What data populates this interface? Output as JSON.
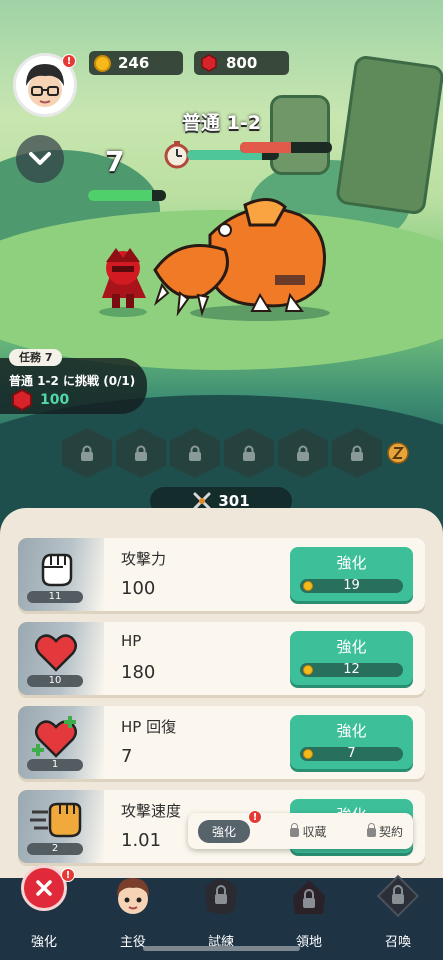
{
  "header": {
    "gold": "246",
    "gems": "800",
    "stage_title": "普通 1-2",
    "wave_number": "7"
  },
  "quest": {
    "tag": "任務 7",
    "description": "普通 1-2 に挑戦 (0/1)",
    "reward": "100"
  },
  "combat_power": "301",
  "upgrades": [
    {
      "name": "攻撃力",
      "value": "100",
      "level": "11",
      "button_label": "強化",
      "cost": "19",
      "icon": "fist-icon"
    },
    {
      "name": "HP",
      "value": "180",
      "level": "10",
      "button_label": "強化",
      "cost": "12",
      "icon": "heart-icon"
    },
    {
      "name": "HP 回復",
      "value": "7",
      "level": "1",
      "button_label": "強化",
      "cost": "7",
      "icon": "heart-regen-icon"
    },
    {
      "name": "攻撃速度",
      "value": "1.01",
      "level": "2",
      "button_label": "強化",
      "cost": "",
      "icon": "speed-fist-icon"
    }
  ],
  "subtabs": {
    "enhance": "強化",
    "collection": "収蔵",
    "contract": "契約"
  },
  "nav": {
    "enhance": "強化",
    "hero": "主役",
    "trial": "試練",
    "territory": "領地",
    "summon": "召喚"
  },
  "badge_text": "!",
  "colors": {
    "accent": "#3dbf9a",
    "navbar": "#1e3344",
    "panel": "#efe8da",
    "hp_green": "#4fd06a",
    "enemy_hp": "#e25a4a"
  }
}
